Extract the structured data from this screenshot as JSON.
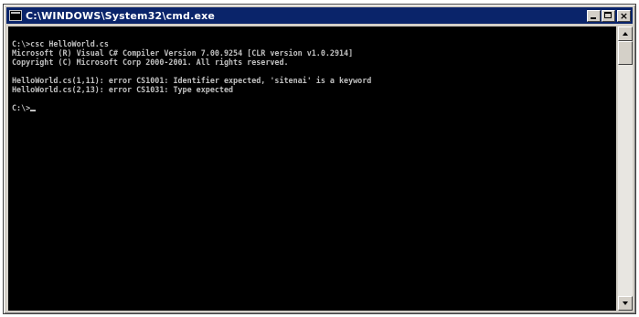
{
  "window": {
    "title": "C:\\WINDOWS\\System32\\cmd.exe",
    "icon": "console-icon",
    "controls": {
      "minimize_icon": "minimize-icon",
      "maximize_icon": "maximize-icon",
      "close_icon": "close-icon",
      "close_glyph": "×"
    }
  },
  "console": {
    "lines": [
      "C:\\>csc HelloWorld.cs",
      "Microsoft (R) Visual C# Compiler Version 7.00.9254 [CLR version v1.0.2914]",
      "Copyright (C) Microsoft Corp 2000-2001. All rights reserved.",
      "",
      "HelloWorld.cs(1,11): error CS1001: Identifier expected, 'sitenai' is a keyword",
      "HelloWorld.cs(2,13): error CS1031: Type expected",
      "",
      "C:\\>"
    ],
    "text_color": "#c0c0c0",
    "background": "#000000"
  },
  "scrollbar": {
    "position": 0.0
  },
  "colors": {
    "titlebar": "#0a246a",
    "chrome": "#d4d0c8"
  }
}
